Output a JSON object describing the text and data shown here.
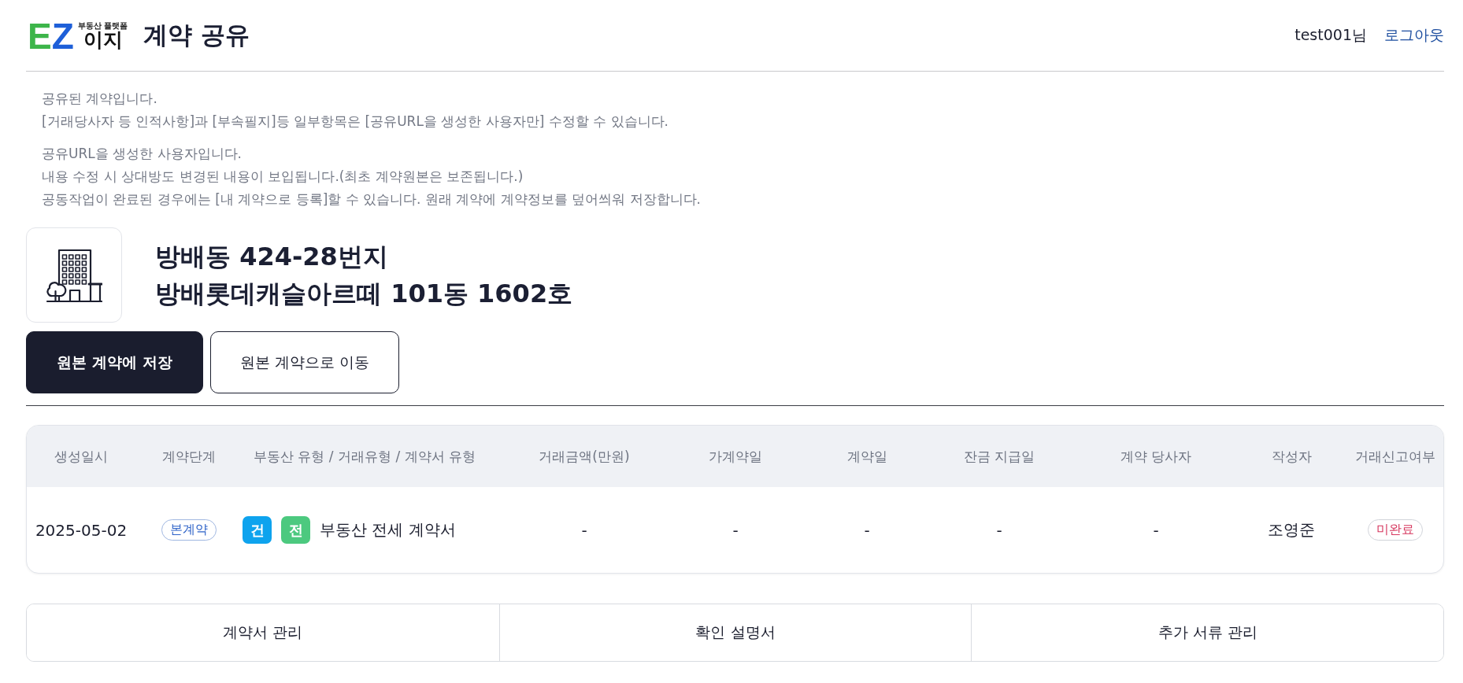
{
  "header": {
    "logo": {
      "letters": [
        {
          "text": "E",
          "color": "#3db54a"
        },
        {
          "text": "Z",
          "color": "#1e5fd8"
        }
      ],
      "tagline": "부동산 플랫폼",
      "name": "이지"
    },
    "title": "계약 공유",
    "user": "test001님",
    "logout": "로그아웃"
  },
  "notices": [
    {
      "lines": [
        "공유된 계약입니다.",
        "[거래당사자 등 인적사항]과 [부속필지]등 일부항목은 [공유URL을 생성한 사용자만] 수정할 수 있습니다."
      ]
    },
    {
      "lines": [
        "공유URL을 생성한 사용자입니다.",
        "내용 수정 시 상대방도 변경된 내용이 보입됩니다.(최초 계약원본은 보존됩니다.)",
        "공동작업이 완료된 경우에는 [내 계약으로 등록]할 수 있습니다. 원래 계약에 계약정보를 덮어씌워 저장합니다."
      ]
    }
  ],
  "property": {
    "address": "방배동 424-28번지",
    "unit": "방배롯데캐슬아르떼 101동 1602호"
  },
  "actions": [
    {
      "label": "원본 계약에 저장",
      "kind": "primary"
    },
    {
      "label": "원본 계약으로 이동",
      "kind": "secondary"
    }
  ],
  "table": {
    "columns": [
      "생성일시",
      "계약단계",
      "부동산 유형 / 거래유형 / 계약서 유형",
      "거래금액(만원)",
      "가계약일",
      "계약일",
      "잔금 지급일",
      "계약 당사자",
      "작성자",
      "거래신고여부"
    ],
    "rows": [
      {
        "created": "2025-05-02",
        "stage": {
          "label": "본계약"
        },
        "tags": [
          {
            "label": "건",
            "color": "#0ea3ee"
          },
          {
            "label": "전",
            "color": "#4cc97f"
          }
        ],
        "contract_type": "부동산 전세 계약서",
        "amount": "-",
        "provisional_date": "-",
        "contract_date": "-",
        "balance_date": "-",
        "parties": "-",
        "author": "조영준",
        "report": {
          "label": "미완료",
          "completed": false
        }
      }
    ]
  },
  "bottom_tabs": [
    {
      "label": "계약서 관리",
      "selected": false
    },
    {
      "label": "확인 설명서",
      "selected": false
    },
    {
      "label": "추가 서류 관리",
      "selected": false
    }
  ]
}
